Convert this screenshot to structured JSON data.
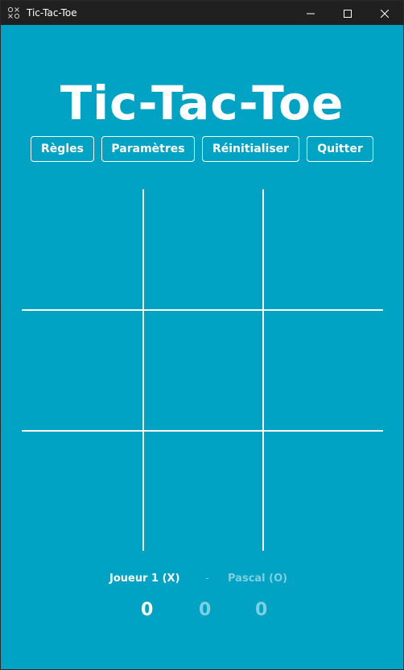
{
  "window": {
    "title": "Tic-Tac-Toe",
    "icon": "tic-tac-toe-icon",
    "controls": [
      "minimize-icon",
      "maximize-icon",
      "close-icon"
    ]
  },
  "app": {
    "title": "Tic-Tac-Toe"
  },
  "menu": {
    "rules": "Règles",
    "settings": "Paramètres",
    "reset": "Réinitialiser",
    "quit": "Quitter"
  },
  "board": {
    "cells": [
      "",
      "",
      "",
      "",
      "",
      "",
      "",
      "",
      ""
    ]
  },
  "scoreboard": {
    "player1": "Joueur 1 (X)",
    "separator": "-",
    "player2": "Pascal (O)",
    "player1_score": "0",
    "draws": "0",
    "player2_score": "0"
  },
  "colors": {
    "background": "#00a3c4",
    "titlebar": "#202020",
    "active_text": "#ffffff",
    "inactive_text": "#7fcfe0"
  }
}
